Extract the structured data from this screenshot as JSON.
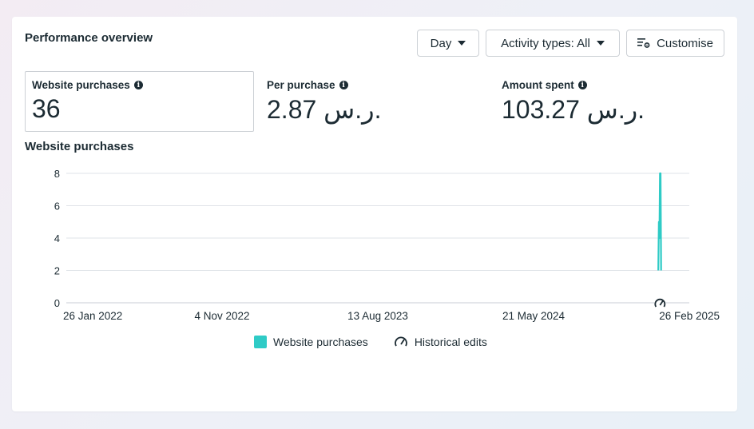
{
  "card": {
    "title": "Performance overview"
  },
  "controls": {
    "day_label": "Day",
    "activity_label": "Activity types: All",
    "customise_label": "Customise"
  },
  "metrics": [
    {
      "label": "Website purchases",
      "value": "36",
      "selected": true
    },
    {
      "label": "Per purchase",
      "value": "2.87 ر.س."
    },
    {
      "label": "Amount spent",
      "value": "103.27 ر.س."
    }
  ],
  "chart_title": "Website purchases",
  "legend": {
    "series_label": "Website purchases",
    "edits_label": "Historical edits"
  },
  "colors": {
    "series": "#2fcbc6",
    "grid": "#dfe3e8",
    "text": "#1c2b33"
  },
  "chart_data": {
    "type": "line",
    "x_ticks": [
      "26 Jan 2022",
      "4 Nov 2022",
      "13 Aug 2023",
      "21 May 2024",
      "26 Feb 2025"
    ],
    "y_ticks": [
      0,
      2,
      4,
      6,
      8
    ],
    "ylim": [
      0,
      8
    ],
    "xlim": [
      "2022-01-26",
      "2025-02-26"
    ],
    "series": [
      {
        "name": "Website purchases",
        "points": [
          {
            "x": "2025-01-01",
            "y": 2
          },
          {
            "x": "2025-01-02",
            "y": 5
          },
          {
            "x": "2025-01-03",
            "y": 4
          },
          {
            "x": "2025-01-04",
            "y": 8
          },
          {
            "x": "2025-01-05",
            "y": 8
          },
          {
            "x": "2025-01-06",
            "y": 2
          }
        ]
      }
    ],
    "annotations": [
      {
        "type": "historical-edit",
        "x": "2025-01-04"
      }
    ]
  }
}
